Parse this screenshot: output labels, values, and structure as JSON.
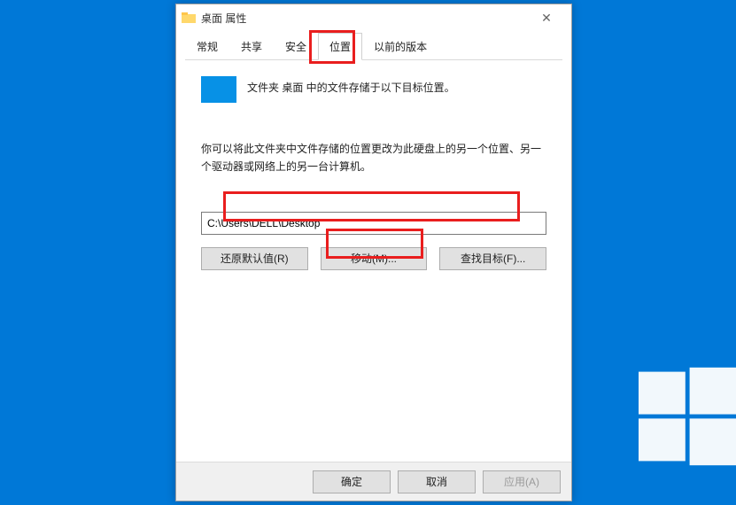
{
  "window": {
    "title": "桌面 属性",
    "close_glyph": "✕"
  },
  "tabs": {
    "t0": "常规",
    "t1": "共享",
    "t2": "安全",
    "t3": "位置",
    "t4": "以前的版本"
  },
  "body": {
    "desc": "文件夹 桌面 中的文件存储于以下目标位置。",
    "para": "你可以将此文件夹中文件存储的位置更改为此硬盘上的另一个位置、另一个驱动器或网络上的另一台计算机。",
    "path": "C:\\Users\\DELL\\Desktop"
  },
  "buttons": {
    "restore": "还原默认值(R)",
    "move": "移动(M)...",
    "find": "查找目标(F)..."
  },
  "footer": {
    "ok": "确定",
    "cancel": "取消",
    "apply": "应用(A)"
  }
}
